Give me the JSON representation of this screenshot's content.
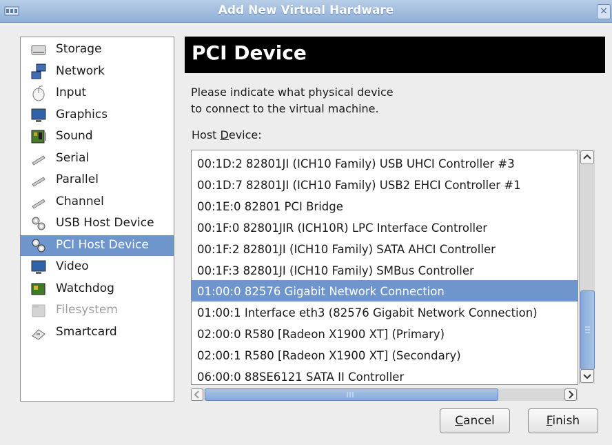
{
  "window": {
    "title": "Add New Virtual Hardware",
    "close_glyph": "×"
  },
  "sidebar": {
    "items": [
      {
        "label": "Storage",
        "icon": "storage-icon",
        "state": "normal"
      },
      {
        "label": "Network",
        "icon": "network-icon",
        "state": "normal"
      },
      {
        "label": "Input",
        "icon": "input-icon",
        "state": "normal"
      },
      {
        "label": "Graphics",
        "icon": "graphics-icon",
        "state": "normal"
      },
      {
        "label": "Sound",
        "icon": "sound-icon",
        "state": "normal"
      },
      {
        "label": "Serial",
        "icon": "serial-icon",
        "state": "normal"
      },
      {
        "label": "Parallel",
        "icon": "parallel-icon",
        "state": "normal"
      },
      {
        "label": "Channel",
        "icon": "channel-icon",
        "state": "normal"
      },
      {
        "label": "USB Host Device",
        "icon": "usb-host-device-icon",
        "state": "normal"
      },
      {
        "label": "PCI Host Device",
        "icon": "pci-host-device-icon",
        "state": "selected"
      },
      {
        "label": "Video",
        "icon": "video-icon",
        "state": "normal"
      },
      {
        "label": "Watchdog",
        "icon": "watchdog-icon",
        "state": "normal"
      },
      {
        "label": "Filesystem",
        "icon": "filesystem-icon",
        "state": "disabled"
      },
      {
        "label": "Smartcard",
        "icon": "smartcard-icon",
        "state": "normal"
      }
    ]
  },
  "main": {
    "heading": "PCI Device",
    "description_line1": "Please indicate what physical device",
    "description_line2": "to connect to the virtual machine.",
    "host_device_label_pre": "Host ",
    "host_device_label_mnemonic": "D",
    "host_device_label_post": "evice:",
    "devices": [
      "00:1D:2 82801JI (ICH10 Family) USB UHCI Controller #3",
      "00:1D:7 82801JI (ICH10 Family) USB2 EHCI Controller #1",
      "00:1E:0 82801 PCI Bridge",
      "00:1F:0 82801JIR (ICH10R) LPC Interface Controller",
      "00:1F:2 82801JI (ICH10 Family) SATA AHCI Controller",
      "00:1F:3 82801JI (ICH10 Family) SMBus Controller",
      "01:00:0 82576 Gigabit Network Connection",
      "01:00:1 Interface eth3 (82576 Gigabit Network Connection)",
      "02:00:0 R580 [Radeon X1900 XT] (Primary)",
      "02:00:1 R580 [Radeon X1900 XT] (Secondary)",
      "06:00:0 88SE6121 SATA II Controller"
    ],
    "selected_device_index": 6
  },
  "buttons": {
    "cancel_mnemonic": "C",
    "cancel_rest": "ancel",
    "finish_mnemonic": "F",
    "finish_rest": "inish"
  },
  "colors": {
    "selection": "#6e95cc",
    "titlebar": "#8fb0d8",
    "banner": "#000000"
  }
}
